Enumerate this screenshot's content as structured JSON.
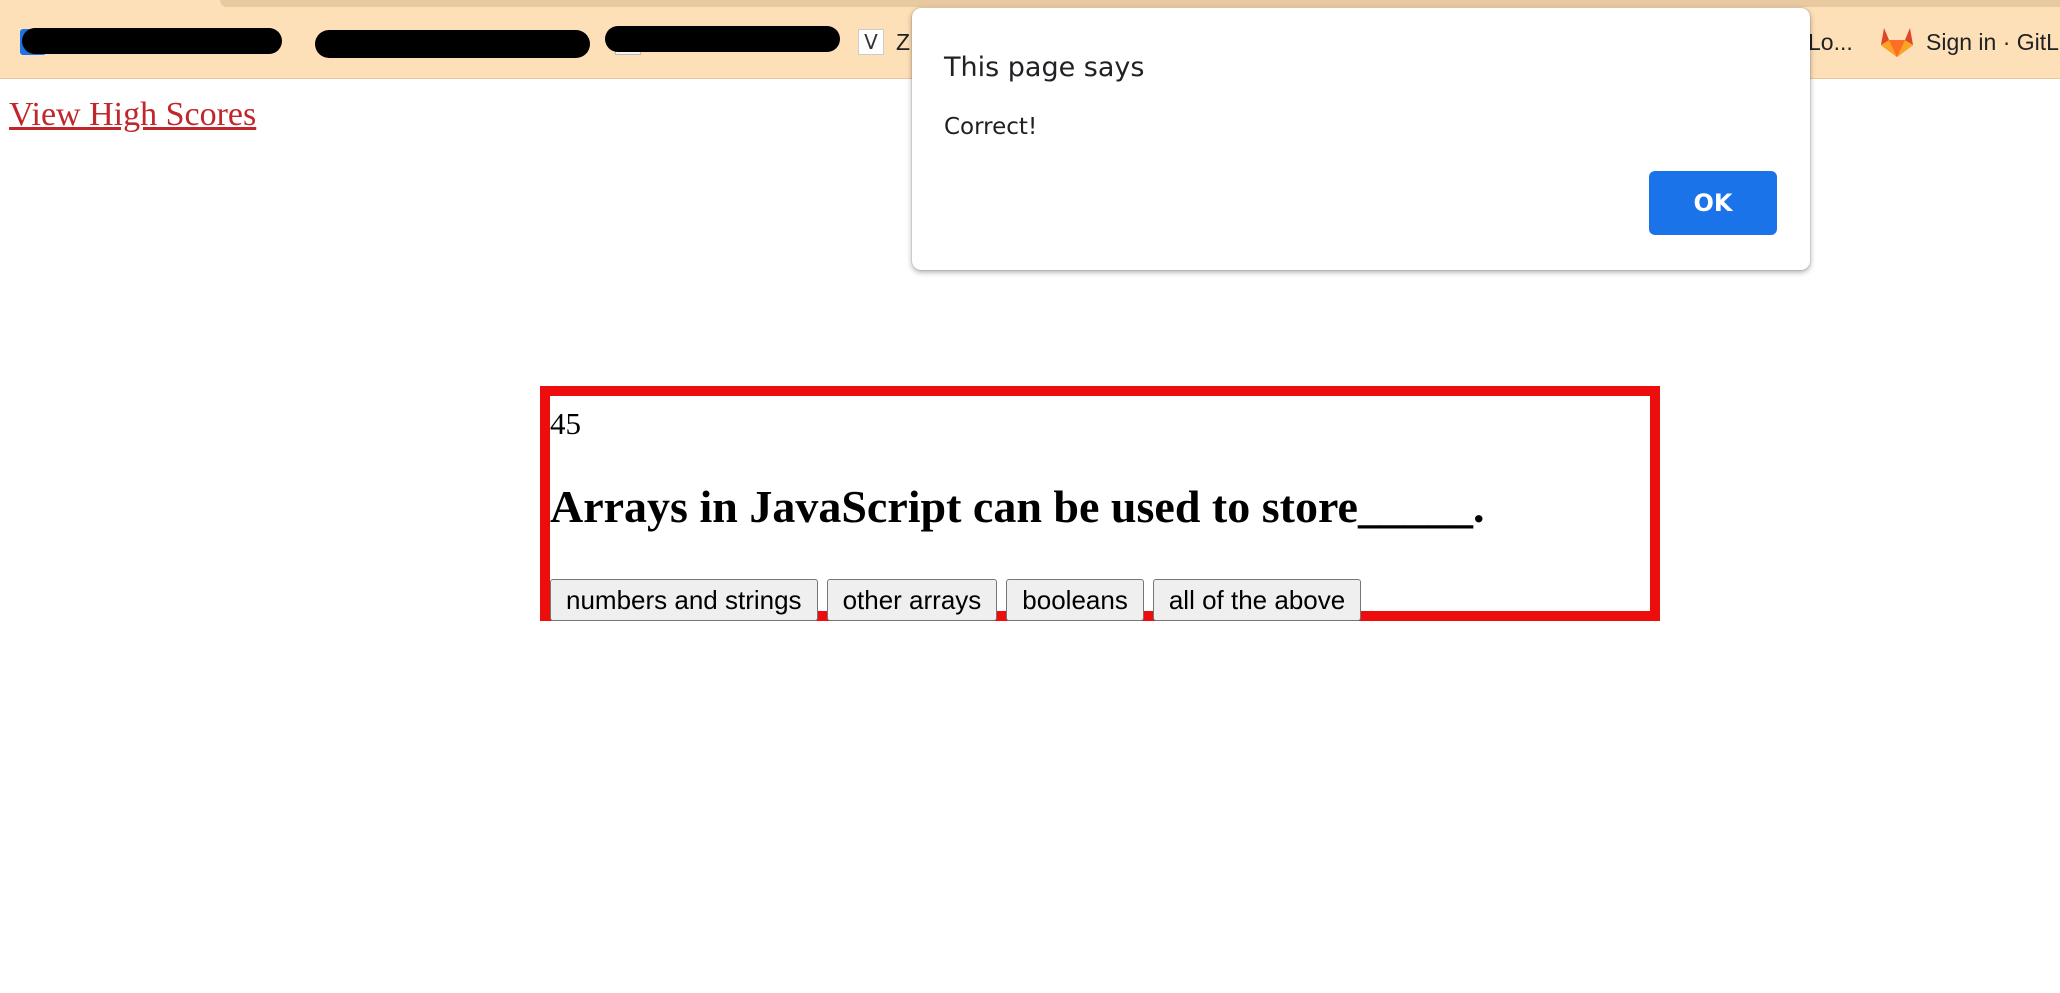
{
  "bookmarks": {
    "item_v_label": "Z",
    "item_partial_label": "Lo...",
    "gitlab_label": "Sign in · GitL"
  },
  "page": {
    "high_scores_link": "View High Scores"
  },
  "quiz": {
    "timer": "45",
    "question": "Arrays in JavaScript can be used to store_____.",
    "answers": [
      "numbers and strings",
      "other arrays",
      "booleans",
      "all of the above"
    ],
    "border_color": "#ee0d0d"
  },
  "alert": {
    "title": "This page says",
    "message": "Correct!",
    "ok_label": "OK",
    "button_color": "#1a73e8"
  }
}
